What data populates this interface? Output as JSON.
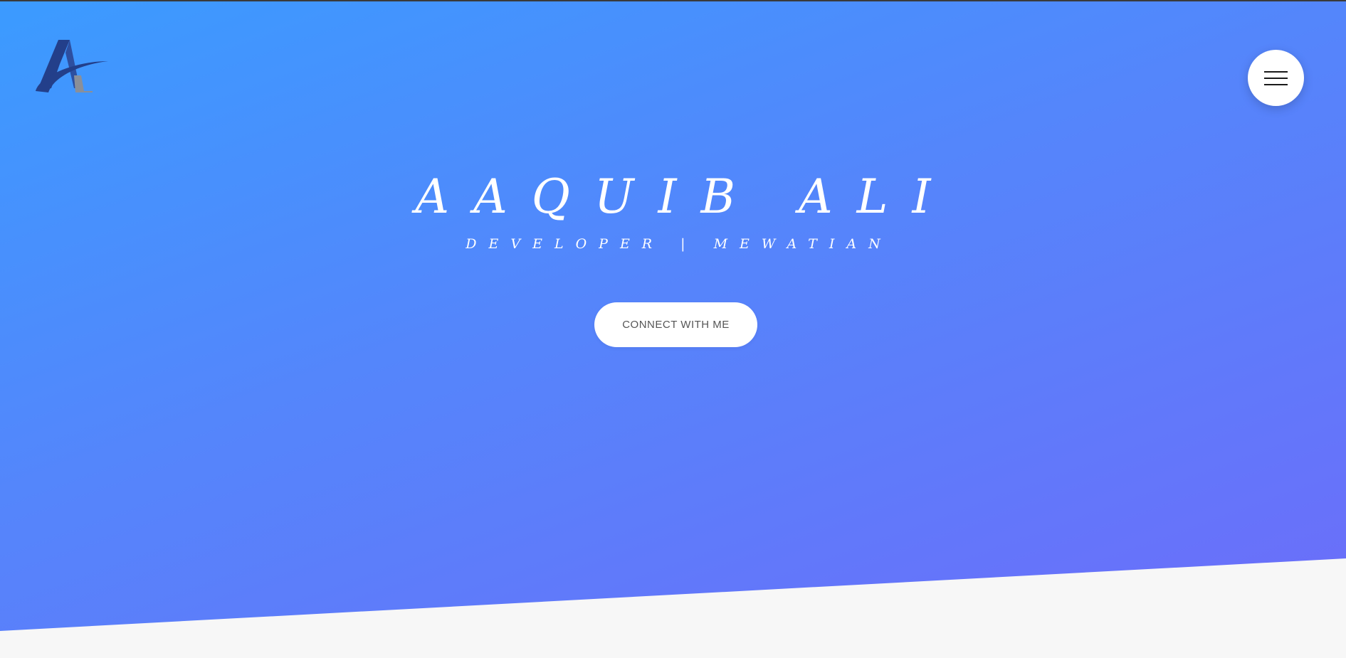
{
  "hero": {
    "title": "AAQUIB ALI",
    "subtitle": "DEVELOPER | MEWATIAN",
    "cta_label": "CONNECT WITH ME"
  },
  "header": {
    "logo_icon": "logo-a-swoosh-icon",
    "menu_icon": "hamburger-menu-icon"
  },
  "colors": {
    "gradient_start": "#3b9bff",
    "gradient_end": "#6d6cf9",
    "page_background": "#f7f7f7",
    "logo_primary": "#233f8a",
    "logo_secondary": "#8a8f99"
  }
}
